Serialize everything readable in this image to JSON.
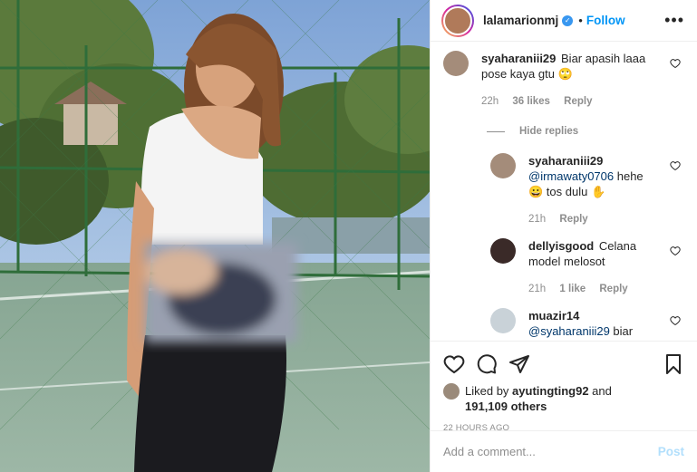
{
  "header": {
    "username": "lalamarionmj",
    "verified_icon": "verified-badge-icon",
    "separator": "•",
    "follow_label": "Follow",
    "more_label": "•••"
  },
  "comments": [
    {
      "username": "syaharaniii29",
      "text": "Biar apasih laaa pose kaya gtu 🙄",
      "time": "22h",
      "likes": "36 likes",
      "reply_label": "Reply"
    }
  ],
  "hide_replies_label": "Hide replies",
  "replies": [
    {
      "username": "syaharaniii29",
      "mention": "@irmawaty0706",
      "text": " hehe 😀 tos dulu ✋",
      "time": "21h",
      "likes": "",
      "reply_label": "Reply"
    },
    {
      "username": "dellyisgood",
      "mention": "",
      "text": "Celana model melosot",
      "time": "21h",
      "likes": "1 like",
      "reply_label": "Reply"
    },
    {
      "username": "muazir14",
      "mention": "@syaharaniii29",
      "text": " biar jangan apa kali",
      "time": "",
      "likes": "",
      "reply_label": ""
    }
  ],
  "actions": {
    "liked_by_prefix": "Liked by ",
    "liked_by_user": "ayutingting92",
    "liked_by_and": " and",
    "others": "191,109 others",
    "timestamp": "22 HOURS AGO"
  },
  "add_comment": {
    "placeholder": "Add a comment...",
    "post_label": "Post"
  },
  "colors": {
    "link_blue": "#0095f6",
    "mention_blue": "#00376b",
    "muted": "#8e8e8e",
    "post_disabled": "#b2dffc"
  }
}
